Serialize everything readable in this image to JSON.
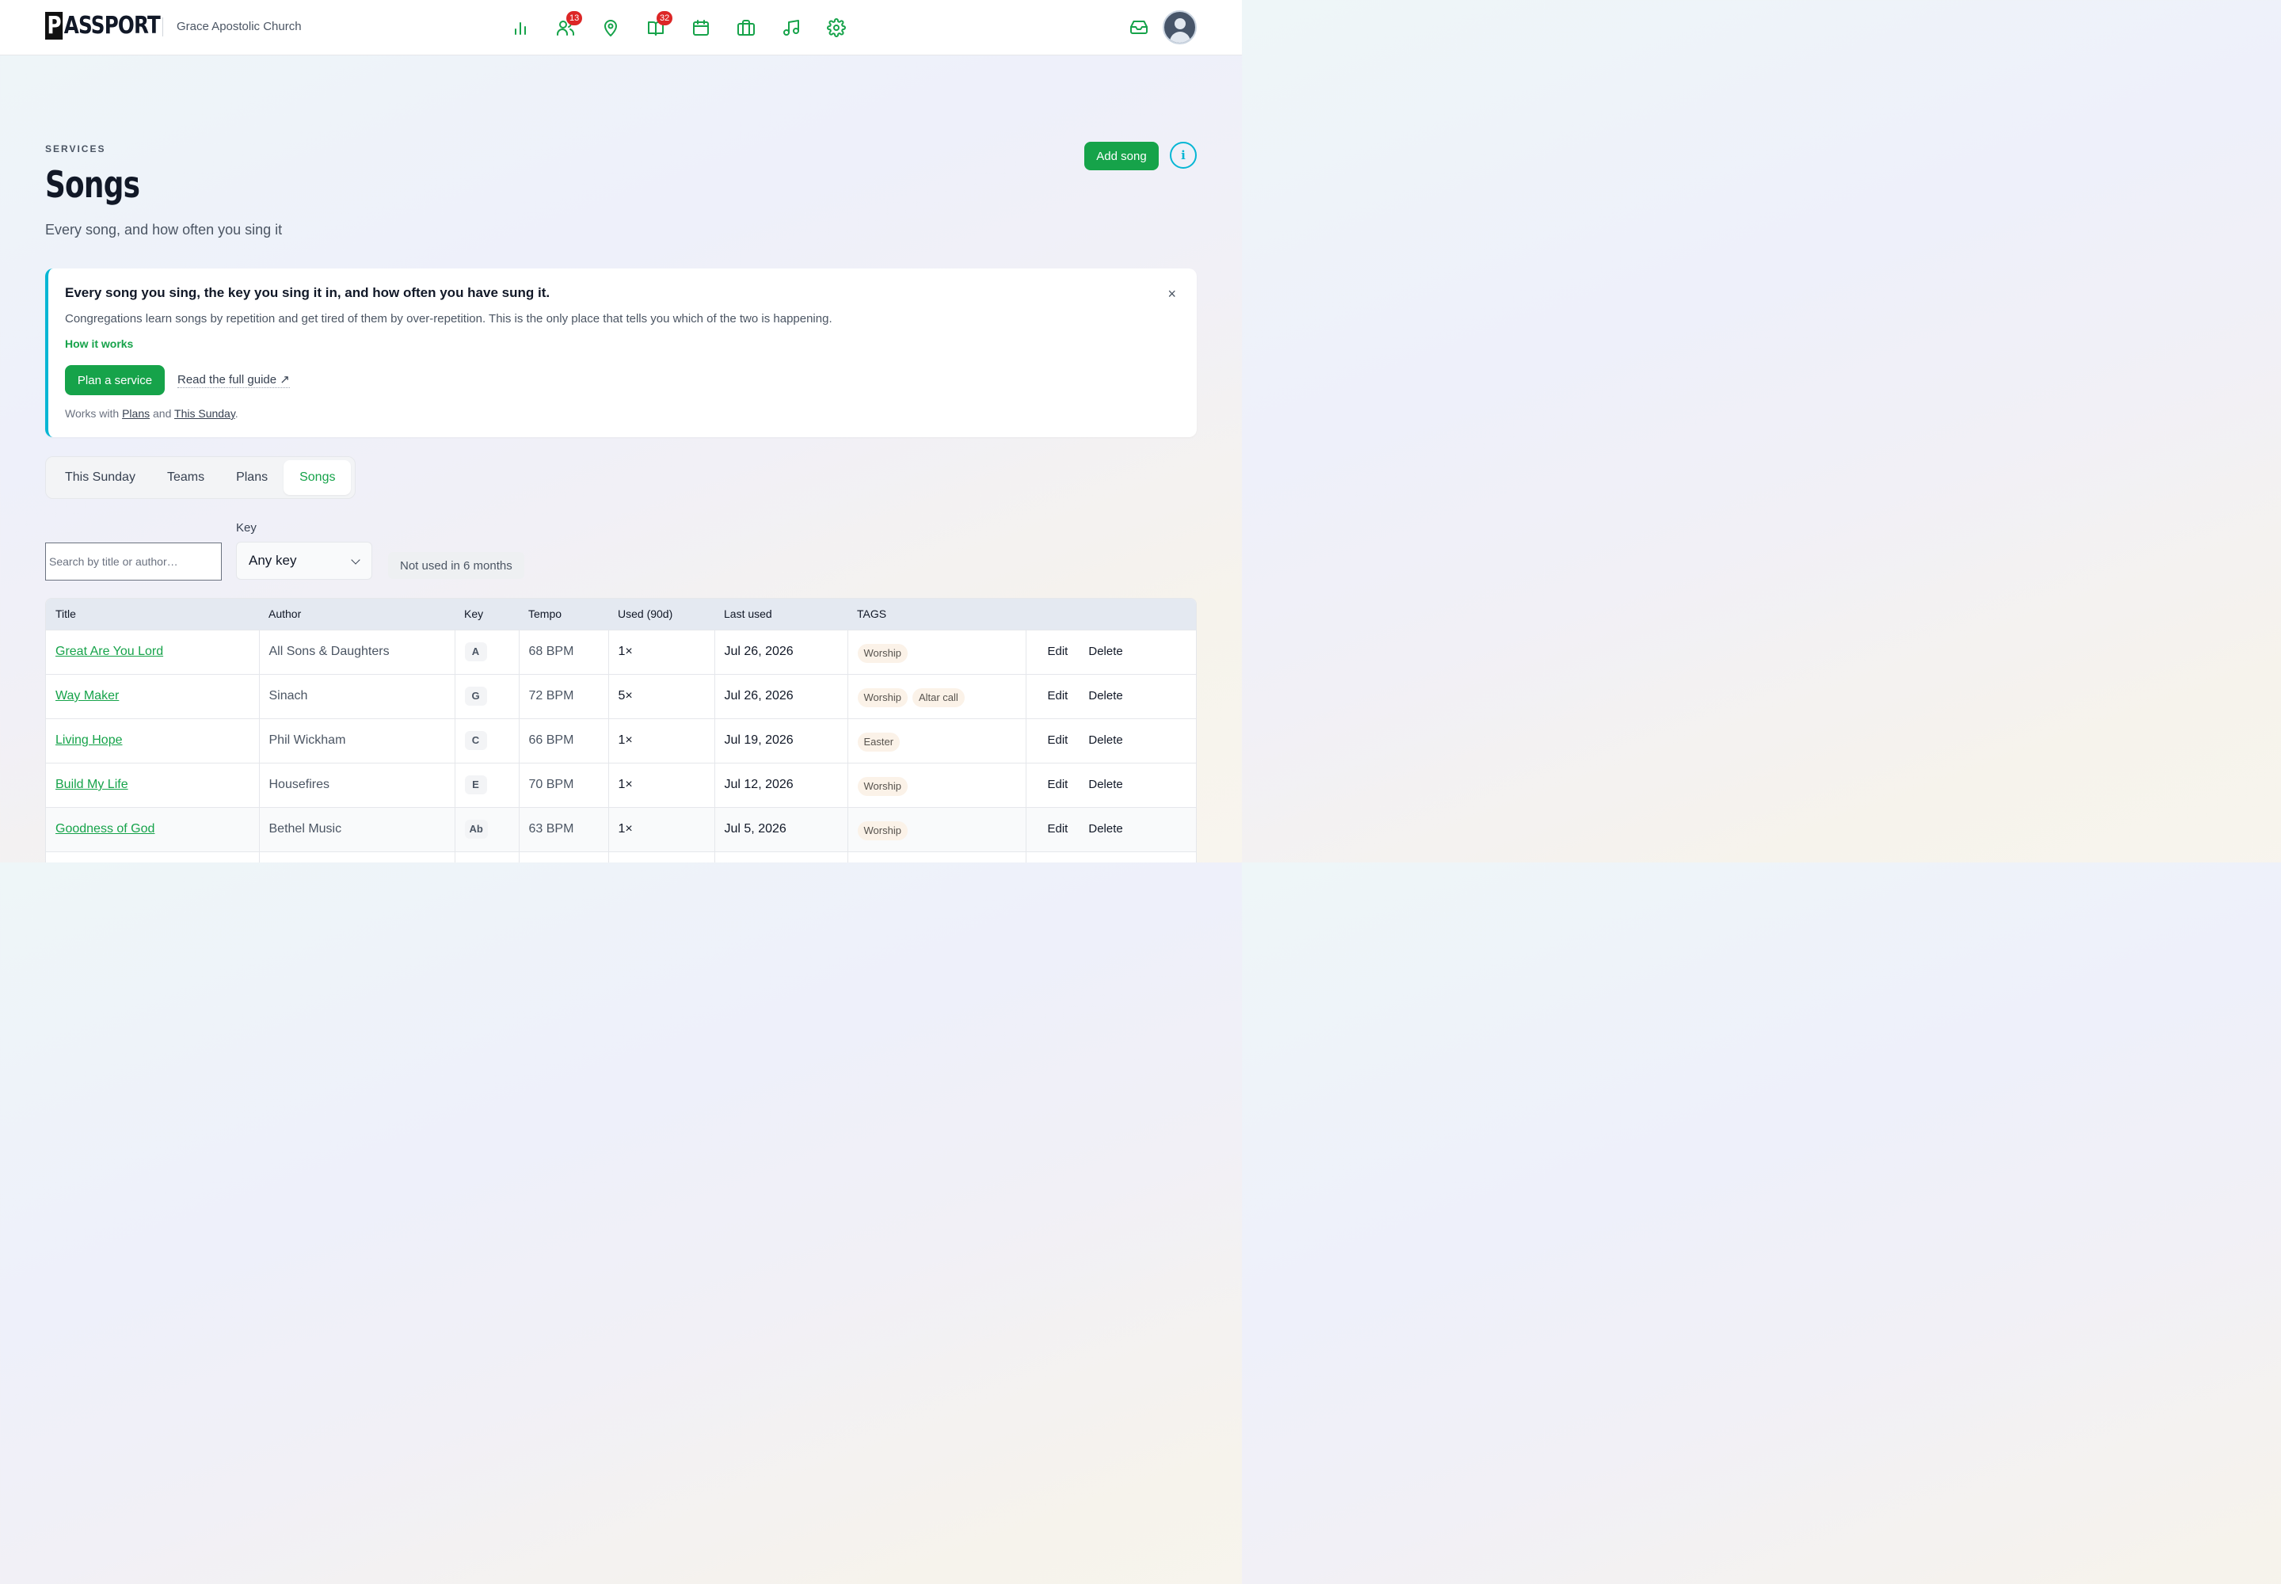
{
  "app": {
    "logo_p": "P",
    "logo_rest": "ASSPORT",
    "org_name": "Grace Apostolic Church"
  },
  "nav": {
    "icons": [
      {
        "name": "reports-icon",
        "badge": null
      },
      {
        "name": "people-icon",
        "badge": "13"
      },
      {
        "name": "location-icon",
        "badge": null
      },
      {
        "name": "groups-icon",
        "badge": "32"
      },
      {
        "name": "calendar-icon",
        "badge": null
      },
      {
        "name": "services-icon",
        "badge": null
      },
      {
        "name": "music-icon",
        "badge": null
      },
      {
        "name": "settings-icon",
        "badge": null
      }
    ],
    "badge_people": "13",
    "badge_groups": "32"
  },
  "header": {
    "eyebrow": "SERVICES",
    "title": "Songs",
    "subtitle": "Every song, and how often you sing it",
    "add_button": "Add song",
    "info_button": "i"
  },
  "info_card": {
    "title": "Every song you sing, the key you sing it in, and how often you have sung it.",
    "description": "Congregations learn songs by repetition and get tired of them by over-repetition. This is the only place that tells you which of the two is happening.",
    "how_it_works": "How it works",
    "plan_button": "Plan a service",
    "guide_link": "Read the full guide ↗",
    "works_with_prefix": "Works with",
    "works_with_link1": "Plans",
    "works_with_and": "and",
    "works_with_link2": "This Sunday",
    "works_with_suffix": ".",
    "close": "×"
  },
  "tabs": [
    "This Sunday",
    "Teams",
    "Plans",
    "Songs"
  ],
  "active_tab": "Songs",
  "filters": {
    "search_placeholder": "Search by title or author…",
    "key_label": "Key",
    "key_value": "Any key",
    "not_used_button": "Not used in 6 months"
  },
  "table": {
    "headers": [
      "Title",
      "Author",
      "Key",
      "Tempo",
      "Used (90d)",
      "Last used",
      "TAGS",
      ""
    ],
    "rows": [
      {
        "title": "Great Are You Lord",
        "author": "All Sons & Daughters",
        "key": "A",
        "tempo": "68 BPM",
        "used": "1×",
        "last_used": "Jul 26, 2026",
        "tags": [
          "Worship"
        ]
      },
      {
        "title": "Way Maker",
        "author": "Sinach",
        "key": "G",
        "tempo": "72 BPM",
        "used": "5×",
        "last_used": "Jul 26, 2026",
        "tags": [
          "Worship",
          "Altar call"
        ]
      },
      {
        "title": "Living Hope",
        "author": "Phil Wickham",
        "key": "C",
        "tempo": "66 BPM",
        "used": "1×",
        "last_used": "Jul 19, 2026",
        "tags": [
          "Easter"
        ]
      },
      {
        "title": "Build My Life",
        "author": "Housefires",
        "key": "E",
        "tempo": "70 BPM",
        "used": "1×",
        "last_used": "Jul 12, 2026",
        "tags": [
          "Worship"
        ]
      },
      {
        "title": "Goodness of God",
        "author": "Bethel Music",
        "key": "Ab",
        "tempo": "63 BPM",
        "used": "1×",
        "last_used": "Jul 5, 2026",
        "tags": [
          "Worship"
        ]
      }
    ],
    "edit_label": "Edit",
    "delete_label": "Delete"
  },
  "colors": {
    "accent": "#16a34a",
    "info": "#06b6d4",
    "badge": "#dc2626"
  }
}
